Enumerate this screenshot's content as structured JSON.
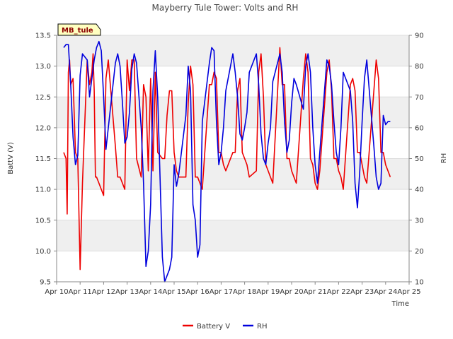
{
  "chart_data": {
    "type": "line",
    "title": "Mayberry Tule Tower: Volts and RH",
    "station_label": "MB_tule",
    "xlabel": "Time",
    "ylabel_left": "BattV (V)",
    "ylabel_right": "RH",
    "x_ticks": [
      "Apr 10",
      "Apr 11",
      "Apr 12",
      "Apr 13",
      "Apr 14",
      "Apr 15",
      "Apr 16",
      "Apr 17",
      "Apr 18",
      "Apr 19",
      "Apr 20",
      "Apr 21",
      "Apr 22",
      "Apr 23",
      "Apr 24",
      "Apr 25"
    ],
    "xlim": [
      0,
      15
    ],
    "ylim_left": [
      9.5,
      13.5
    ],
    "ylim_right": [
      10,
      90
    ],
    "yticks_left": [
      "9.5",
      "10.0",
      "10.5",
      "11.0",
      "11.5",
      "12.0",
      "12.5",
      "13.0",
      "13.5"
    ],
    "yticks_right": [
      "10",
      "20",
      "30",
      "40",
      "50",
      "60",
      "70",
      "80",
      "90"
    ],
    "grid": true,
    "legend_position": "bottom",
    "colors": {
      "battery": "#ee0000",
      "rh": "#0000dd"
    },
    "series": [
      {
        "name": "Battery V",
        "axis": "left",
        "x": [
          0.3,
          0.4,
          0.45,
          0.5,
          0.55,
          0.6,
          0.7,
          0.8,
          0.9,
          1.0,
          1.1,
          1.3,
          1.4,
          1.5,
          1.55,
          1.6,
          1.65,
          1.7,
          1.8,
          1.9,
          2.0,
          2.1,
          2.2,
          2.5,
          2.6,
          2.7,
          2.8,
          2.9,
          3.0,
          3.1,
          3.2,
          3.3,
          3.4,
          3.6,
          3.7,
          3.8,
          3.9,
          4.0,
          4.1,
          4.2,
          4.3,
          4.5,
          4.6,
          4.7,
          4.8,
          4.9,
          5.0,
          5.1,
          5.2,
          5.5,
          5.6,
          5.7,
          5.8,
          5.9,
          6.0,
          6.1,
          6.2,
          6.5,
          6.6,
          6.7,
          6.8,
          6.9,
          7.0,
          7.1,
          7.2,
          7.5,
          7.6,
          7.7,
          7.8,
          7.9,
          8.0,
          8.1,
          8.2,
          8.5,
          8.6,
          8.7,
          8.8,
          8.9,
          9.0,
          9.1,
          9.2,
          9.5,
          9.6,
          9.7,
          9.8,
          9.9,
          10.0,
          10.1,
          10.2,
          10.5,
          10.6,
          10.7,
          10.8,
          10.9,
          11.0,
          11.1,
          11.2,
          11.5,
          11.6,
          11.7,
          11.8,
          11.9,
          12.0,
          12.1,
          12.2,
          12.5,
          12.6,
          12.7,
          12.8,
          12.9,
          13.0,
          13.1,
          13.2,
          13.5,
          13.6,
          13.7,
          13.8,
          13.9,
          14.0,
          14.1,
          14.2
        ],
        "values": [
          11.6,
          11.5,
          10.6,
          12.9,
          13.1,
          12.7,
          12.8,
          11.6,
          11.5,
          9.7,
          11.1,
          13.1,
          12.7,
          12.9,
          13.2,
          12.6,
          11.2,
          11.2,
          11.1,
          11.0,
          10.9,
          12.8,
          13.1,
          11.7,
          11.2,
          11.2,
          11.1,
          11.0,
          13.1,
          12.6,
          13.1,
          13.1,
          11.5,
          11.2,
          12.7,
          12.5,
          11.3,
          12.8,
          11.3,
          12.9,
          11.6,
          11.5,
          11.5,
          12.2,
          12.6,
          12.6,
          11.6,
          11.3,
          11.2,
          11.2,
          12.4,
          13.0,
          12.7,
          11.2,
          11.2,
          11.1,
          11.0,
          12.7,
          12.7,
          12.9,
          12.8,
          11.6,
          11.6,
          11.4,
          11.3,
          11.6,
          11.6,
          12.6,
          12.8,
          11.6,
          11.5,
          11.4,
          11.2,
          11.3,
          12.9,
          13.2,
          12.5,
          11.4,
          11.3,
          11.2,
          11.1,
          13.3,
          12.7,
          12.7,
          11.5,
          11.5,
          11.3,
          11.2,
          11.1,
          12.8,
          13.2,
          12.9,
          11.5,
          11.4,
          11.1,
          11.0,
          11.3,
          12.9,
          13.1,
          12.6,
          11.5,
          11.5,
          11.3,
          11.2,
          11.0,
          12.7,
          12.8,
          12.6,
          11.6,
          11.6,
          11.4,
          11.2,
          11.1,
          12.6,
          13.1,
          12.8,
          11.6,
          11.6,
          11.4,
          11.3,
          11.2
        ]
      },
      {
        "name": "RH",
        "axis": "right",
        "x": [
          0.3,
          0.4,
          0.5,
          0.6,
          0.7,
          0.8,
          0.9,
          1.0,
          1.1,
          1.3,
          1.4,
          1.5,
          1.6,
          1.7,
          1.8,
          1.9,
          2.0,
          2.1,
          2.2,
          2.5,
          2.6,
          2.7,
          2.8,
          2.9,
          3.0,
          3.1,
          3.2,
          3.3,
          3.4,
          3.6,
          3.7,
          3.8,
          3.9,
          4.0,
          4.1,
          4.2,
          4.3,
          4.5,
          4.6,
          4.7,
          4.8,
          4.9,
          5.0,
          5.1,
          5.2,
          5.5,
          5.6,
          5.7,
          5.8,
          5.9,
          6.0,
          6.1,
          6.2,
          6.5,
          6.6,
          6.7,
          6.8,
          6.9,
          7.0,
          7.1,
          7.2,
          7.5,
          7.6,
          7.7,
          7.8,
          7.9,
          8.0,
          8.1,
          8.2,
          8.5,
          8.6,
          8.7,
          8.8,
          8.9,
          9.0,
          9.1,
          9.2,
          9.5,
          9.6,
          9.7,
          9.8,
          9.9,
          10.0,
          10.1,
          10.2,
          10.5,
          10.6,
          10.7,
          10.8,
          10.9,
          11.0,
          11.1,
          11.2,
          11.5,
          11.6,
          11.7,
          11.8,
          11.9,
          12.0,
          12.1,
          12.2,
          12.5,
          12.6,
          12.7,
          12.8,
          12.9,
          13.0,
          13.1,
          13.2,
          13.5,
          13.6,
          13.7,
          13.8,
          13.9,
          14.0,
          14.1,
          14.2
        ],
        "values": [
          86,
          87,
          87,
          74,
          57,
          48,
          51,
          77,
          84,
          82,
          70,
          76,
          82,
          86,
          88,
          85,
          70,
          53,
          60,
          81,
          84,
          80,
          68,
          55,
          57,
          65,
          79,
          84,
          81,
          60,
          42,
          15,
          20,
          35,
          72,
          85,
          70,
          18,
          10,
          12,
          14,
          18,
          48,
          41,
          45,
          64,
          80,
          72,
          35,
          30,
          18,
          22,
          62,
          81,
          86,
          85,
          62,
          48,
          52,
          60,
          72,
          84,
          78,
          70,
          58,
          56,
          60,
          65,
          78,
          84,
          74,
          58,
          50,
          48,
          55,
          60,
          75,
          84,
          78,
          62,
          52,
          56,
          68,
          76,
          74,
          66,
          80,
          84,
          78,
          60,
          48,
          42,
          52,
          82,
          80,
          74,
          62,
          52,
          48,
          60,
          78,
          72,
          62,
          42,
          34,
          46,
          62,
          76,
          82,
          54,
          44,
          40,
          42,
          64,
          61,
          62,
          62
        ]
      }
    ]
  }
}
